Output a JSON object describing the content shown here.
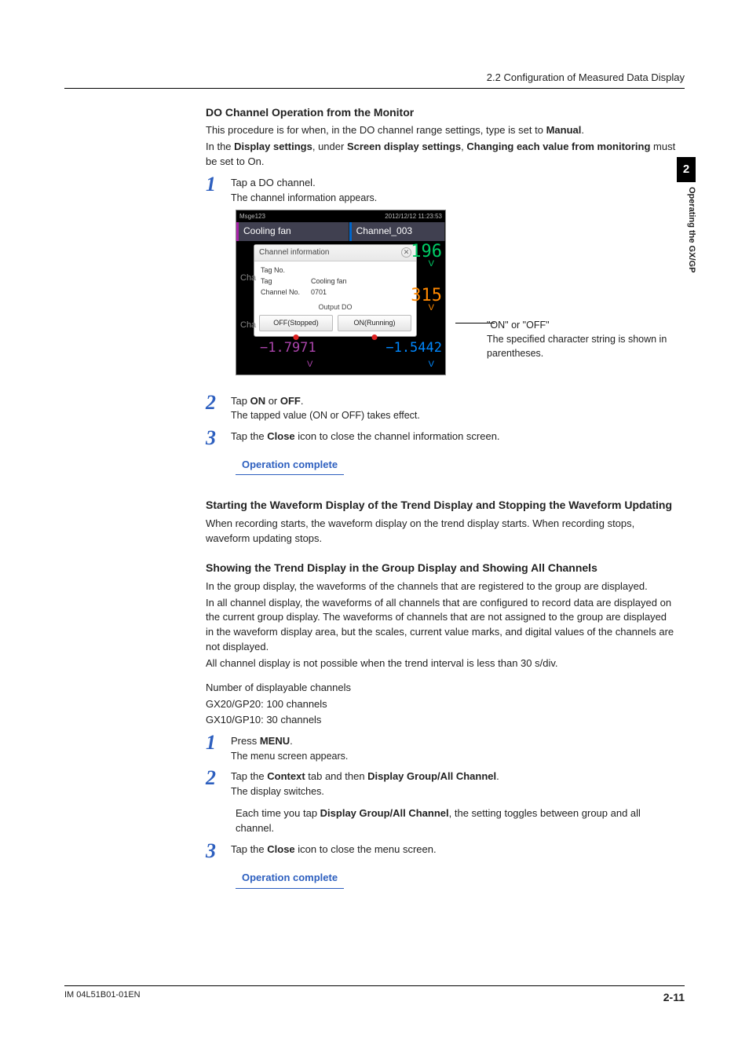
{
  "header": {
    "section_ref": "2.2  Configuration of Measured Data Display"
  },
  "sidetab": {
    "num": "2",
    "label": "Operating the GX/GP"
  },
  "s1": {
    "title": "DO Channel Operation from the Monitor",
    "intro1a": "This procedure is for when, in the DO channel range settings, type is set to ",
    "intro1b": "Manual",
    "intro1c": ".",
    "intro2a": "In the ",
    "intro2b": "Display settings",
    "intro2c": ", under ",
    "intro2d": "Screen display settings",
    "intro2e": ", ",
    "intro2f": "Changing each value from monitoring",
    "intro2g": " must be set to On.",
    "step1": {
      "n": "1",
      "line": "Tap a DO channel.",
      "sub": "The channel information appears."
    },
    "step2": {
      "n": "2",
      "a": "Tap ",
      "b": "ON",
      "c": " or ",
      "d": "OFF",
      "e": ".",
      "sub": "The tapped value (ON or OFF) takes effect."
    },
    "step3": {
      "n": "3",
      "a": "Tap the ",
      "b": "Close",
      "c": " icon to close the channel information screen."
    },
    "op_complete": "Operation complete"
  },
  "shot": {
    "titlebar_left": "Msge123",
    "titlebar_right": "2012/12/12 11:23:53",
    "label_a": "Cooling fan",
    "label_b": "Channel_003",
    "popup_title": "Channel  information",
    "k1": "Tag No.",
    "k2": "Tag",
    "v2": "Cooling fan",
    "k3": "Channel No.",
    "v3": "0701",
    "output_label": "Output  DO",
    "btn_off": "OFF(Stopped)",
    "btn_on": "ON(Running)",
    "ch_tag": "Cha",
    "num1": "196",
    "num2": "315",
    "num3a": "−1.7971",
    "num3b": "−1.5442",
    "unit": "V"
  },
  "annot": {
    "l1": "\"ON\" or \"OFF\"",
    "l2": "The specified character string is shown in parentheses."
  },
  "s2": {
    "title": "Starting the Waveform Display of the Trend Display and Stopping the Waveform Updating",
    "body": "When recording starts, the waveform display on the trend display starts. When recording stops, waveform updating stops."
  },
  "s3": {
    "title": "Showing the Trend Display in the Group Display and Showing All Channels",
    "p1": "In the group display, the waveforms of the channels that are registered to the group are displayed.",
    "p2": "In all channel display, the waveforms of all channels that are configured to record data are displayed on the current group display. The waveforms of channels that are not assigned to the group are displayed in the waveform display area, but the scales, current value marks, and digital values of the channels are not displayed.",
    "p3": "All channel display is not possible when the trend interval is less than 30 s/div.",
    "p4": "Number of displayable channels",
    "p5": "GX20/GP20: 100 channels",
    "p6": "GX10/GP10: 30 channels",
    "step1": {
      "n": "1",
      "a": "Press ",
      "b": "MENU",
      "c": ".",
      "sub": "The menu screen appears."
    },
    "step2": {
      "n": "2",
      "a": "Tap the ",
      "b": "Context",
      "c": " tab and then ",
      "d": "Display  Group/All Channel",
      "e": ".",
      "sub": "The display switches."
    },
    "note_a": "Each time you tap ",
    "note_b": "Display  Group/All Channel",
    "note_c": ", the setting toggles between group and all channel.",
    "step3": {
      "n": "3",
      "a": "Tap the ",
      "b": "Close",
      "c": " icon to close the menu screen."
    },
    "op_complete": "Operation complete"
  },
  "footer": {
    "doc": "IM 04L51B01-01EN",
    "page": "2-11"
  }
}
